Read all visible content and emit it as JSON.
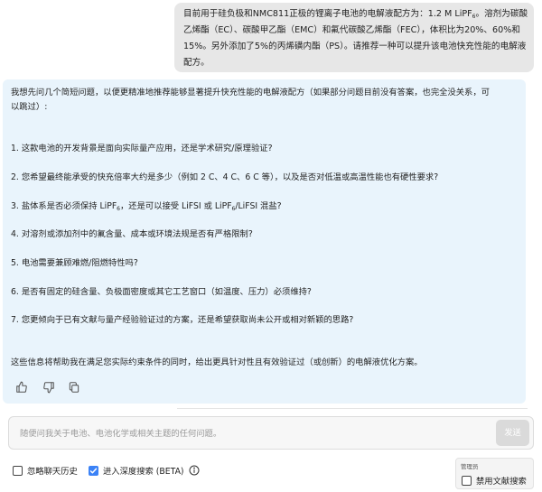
{
  "user_message": {
    "lines": [
      [
        "目前用于硅负极和NMC811正极的锂离子电池的电解液配方为：1.2 M LiPF",
        "6",
        "。溶剂为碳酸"
      ],
      [
        "乙烯酯（EC）、碳酸甲乙酯（EMC）和氟代碳酸乙烯酯（FEC），体积比为20%、60%和"
      ],
      [
        "15%。另外添加了5%的丙烯磺内酯（PS）。请推荐一种可以提升该电池快充性能的电解液"
      ],
      [
        "配方。"
      ]
    ]
  },
  "assistant_message": {
    "intro_line1": "我想先问几个简短问题，以便更精准地推荐能够显著提升快充性能的电解液配方（如果部分问题目前没有答案，也完全没关系，可",
    "intro_line2": "以跳过）:",
    "questions": [
      {
        "text": "1. 这款电池的开发背景是面向实际量产应用，还是学术研究/原理验证?"
      },
      {
        "text": "2. 您希望最终能承受的快充倍率大约是多少（例如 2 C、4 C、6 C 等），以及是否对低温或高温性能也有硬性要求?"
      },
      {
        "pre": "3. 盐体系是否必须保持 LiPF",
        "sub1": "6",
        "mid": "，还是可以接受 LiFSI 或 LiPF",
        "sub2": "6",
        "post": "/LiFSI 混盐?"
      },
      {
        "text": "4. 对溶剂或添加剂中的氟含量、成本或环境法规是否有严格限制?"
      },
      {
        "text": "5. 电池需要兼顾难燃/阻燃特性吗?"
      },
      {
        "text": "6. 是否有固定的硅含量、负极面密度或其它工艺窗口（如温度、压力）必须维持?"
      },
      {
        "text": "7. 您更倾向于已有文献与量产经验验证过的方案，还是希望获取尚未公开或相对新颖的思路?"
      }
    ],
    "closing": "这些信息将帮助我在满足您实际约束条件的同时，给出更具针对性且有效验证过（或创新）的电解液优化方案。",
    "feedback_icons": [
      "thumbs-up-icon",
      "thumbs-down-icon",
      "copy-icon"
    ]
  },
  "composer": {
    "placeholder": "随便问我关于电池、电池化学或相关主题的任何问题。",
    "send_label": "发送"
  },
  "options": {
    "ignore_history": {
      "label": "忽略聊天历史",
      "checked": false
    },
    "deep_search": {
      "label": "进入深度搜索 (BETA)",
      "checked": true,
      "icon": "info-icon"
    }
  },
  "admin": {
    "label": "管理员",
    "disable_literature": {
      "label": "禁用文献搜索",
      "checked": false
    }
  },
  "colors": {
    "user_bubble": "#e7e7e7",
    "assistant_bg": "#e9f4fc",
    "checkbox_accent": "#3b82f6",
    "send_disabled": "#dadada"
  }
}
